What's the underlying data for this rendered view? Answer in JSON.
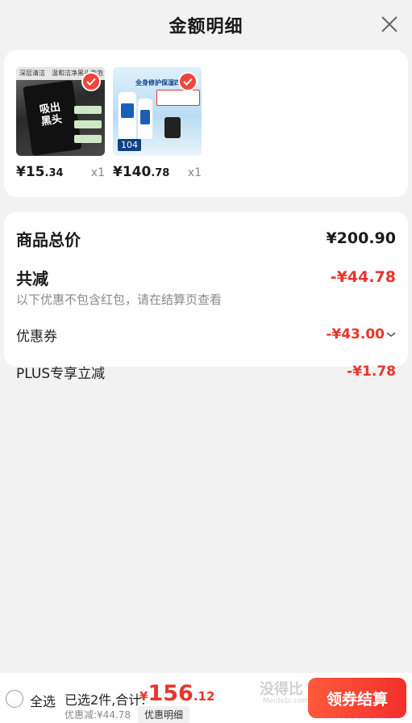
{
  "header": {
    "title": "金额明细"
  },
  "products": [
    {
      "price_int": "¥15",
      "price_dec": ".34",
      "qty": "x1",
      "art": [
        "深层清洁",
        "温和洁净黑头泡泡",
        "吸出黑头"
      ]
    },
    {
      "price_int": "¥140",
      "price_dec": ".78",
      "qty": "x1",
      "art": [
        "全身修护保湿四件套",
        "104"
      ]
    }
  ],
  "summary": {
    "total_label": "商品总价",
    "total_value": "¥200.90",
    "reduce_label": "共减",
    "reduce_value": "-¥44.78",
    "note": "以下优惠不包含红包，请在结算页查看",
    "coupon_label": "优惠券",
    "coupon_value": "-¥43.00",
    "plus_label": "PLUS专享立减",
    "plus_value": "-¥1.78"
  },
  "footer": {
    "select_all": "全选",
    "selected_info": "已选2件,合计:",
    "currency": "¥",
    "total_int": "156",
    "total_dec": ".12",
    "discount_line": "优惠减:¥44.78",
    "detail_button": "优惠明细",
    "checkout_button": "领券结算",
    "watermark": "没得比",
    "watermark_sub": "Meidebi.com"
  },
  "colors": {
    "accent": "#e8352c",
    "checkout": "#f2302b",
    "background": "#f2f2f2"
  }
}
